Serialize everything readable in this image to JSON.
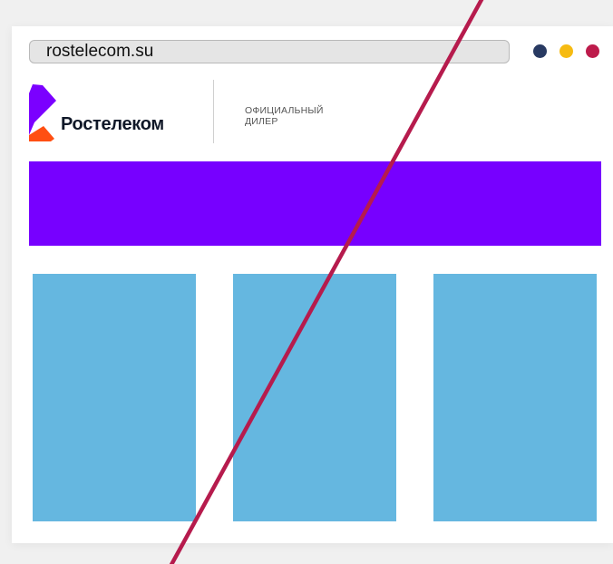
{
  "browser": {
    "url": "rostelecom.su",
    "dots": [
      "#283a62",
      "#f6bb12",
      "#bd1b4b"
    ]
  },
  "header": {
    "brand_name": "Ростелеком",
    "dealer_line1": "ОФИЦИАЛЬНЫЙ",
    "dealer_line2": "ДИЛЕР"
  },
  "colors": {
    "logo_purple": "#7b00ff",
    "logo_orange": "#ff4f12",
    "banner": "#7700ff",
    "card": "#65b7e0",
    "strike": "#b61b4d"
  },
  "icons": {
    "logo": "rostelecom-logo-icon",
    "strike": "diagonal-strike-line"
  },
  "cards_count": 3
}
